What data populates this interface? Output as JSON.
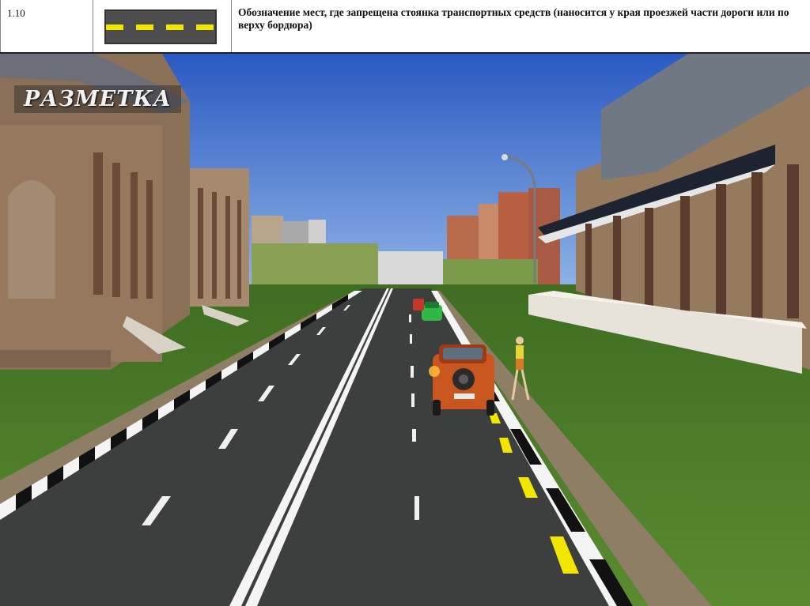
{
  "header": {
    "number": "1.10",
    "description": "Обозначение мест, где запрещена стоянка транспортных средств (наносится у края проезжей части дороги или по верху бордюра)",
    "sample_marking": {
      "base_color": "#4d4d4d",
      "stripe_color": "#f2e600",
      "pattern": "dashed yellow line"
    }
  },
  "scene": {
    "title": "РАЗМЕТКА",
    "colors": {
      "sky": "#2f62c8",
      "road": "#3d3f3f",
      "grass": "#4c7a2a",
      "curb_dark": "#111111",
      "curb_light": "#f4f4f4",
      "yellow_marking": "#f2e600",
      "car": "#c8561e"
    },
    "objects": [
      "building-left-icon",
      "building-right-icon",
      "city-skyline-icon",
      "street-lamp-icon",
      "suv-car-icon",
      "green-car-icon",
      "pedestrian-icon"
    ]
  }
}
